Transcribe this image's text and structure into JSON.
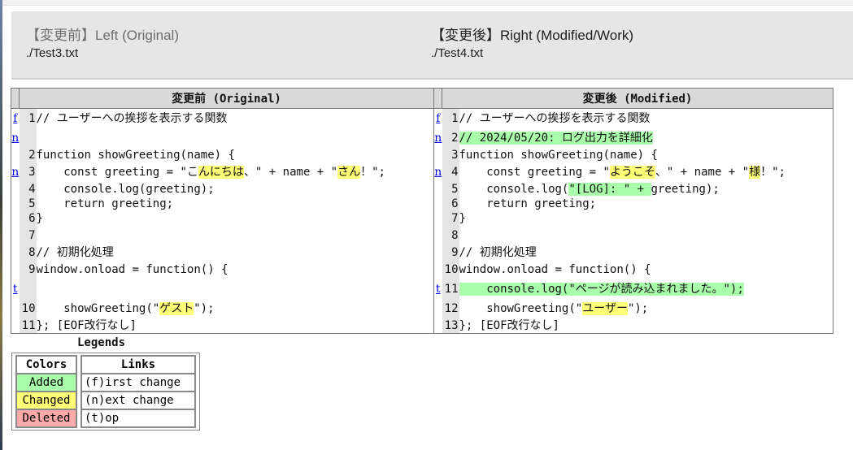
{
  "header": {
    "left_title": "【変更前】Left (Original)",
    "left_path": "./Test3.txt",
    "right_title": "【変更後】Right (Modified/Work)",
    "right_path": "./Test4.txt"
  },
  "table": {
    "left_heading": "変更前 (Original)",
    "right_heading": "変更後 (Modified)"
  },
  "rows": [
    {
      "ln": "f",
      "lnum": "1",
      "lcode": "// ユーザーへの挨拶を表示する関数",
      "rn": "f",
      "rnum": "1",
      "rcode": "// ユーザーへの挨拶を表示する関数"
    },
    {
      "ln": "n",
      "lnum": "",
      "lcode": "",
      "rn": "n",
      "rnum": "2",
      "rcode": "// 2024/05/20: ログ出力を詳細化"
    },
    {
      "ln": "",
      "lnum": "2",
      "lcode": "function showGreeting(name) {",
      "rn": "",
      "rnum": "3",
      "rcode": "function showGreeting(name) {"
    },
    {
      "ln": "n",
      "lnum": "3",
      "lcode_a": "    const greeting = \"こ",
      "lcode_b": "んにちは",
      "lcode_c": "、\" + name + \"",
      "lcode_d": "さん",
      "lcode_e": "！\";",
      "rn": "n",
      "rnum": "4",
      "rcode_a": "    const greeting = \"",
      "rcode_b": "ようこ",
      "rcode_c": "そ",
      "rcode_d": "、\" + name + \"",
      "rcode_e": "様",
      "rcode_f": "！\";"
    },
    {
      "ln": "",
      "lnum": "4",
      "lcode": "    console.log(greeting);",
      "rn": "",
      "rnum": "5",
      "rcode_a": "    console.log(",
      "rcode_b": "\"[LOG]: \" + ",
      "rcode_c": "greeting);"
    },
    {
      "ln": "",
      "lnum": "5",
      "lcode": "    return greeting;",
      "rn": "",
      "rnum": "6",
      "rcode": "    return greeting;"
    },
    {
      "ln": "",
      "lnum": "6",
      "lcode": "}",
      "rn": "",
      "rnum": "7",
      "rcode": "}"
    },
    {
      "ln": "",
      "lnum": "7",
      "lcode": "",
      "rn": "",
      "rnum": "8",
      "rcode": ""
    },
    {
      "ln": "",
      "lnum": "8",
      "lcode": "// 初期化処理",
      "rn": "",
      "rnum": "9",
      "rcode": "// 初期化処理"
    },
    {
      "ln": "",
      "lnum": "9",
      "lcode": "window.onload = function() {",
      "rn": "",
      "rnum": "10",
      "rcode": "window.onload = function() {"
    },
    {
      "ln": "t",
      "lnum": "",
      "lcode": "",
      "rn": "t",
      "rnum": "11",
      "rcode": "    console.log(\"ページが読み込まれました。\");"
    },
    {
      "ln": "",
      "lnum": "10",
      "lcode_a": "    showGreeting(\"",
      "lcode_b": "ゲスト",
      "lcode_c": "\");",
      "rn": "",
      "rnum": "12",
      "rcode_a": "    showGreeting(\"",
      "rcode_b": "ユーザー",
      "rcode_c": "\");"
    },
    {
      "ln": "",
      "lnum": "11",
      "lcode": "}; [EOF改行なし]",
      "rn": "",
      "rnum": "13",
      "rcode": "}; [EOF改行なし]"
    }
  ],
  "legend": {
    "title": "Legends",
    "colors_heading": "Colors",
    "added": "Added",
    "changed": "Changed",
    "deleted": "Deleted",
    "links_heading": "Links",
    "first": "(f)irst change",
    "next": "(n)ext change",
    "top": "(t)op"
  },
  "colors": {
    "added": "#aaffaa",
    "changed": "#ffff77",
    "deleted": "#ffaaaa",
    "header_bg": "#e6e6e6"
  }
}
